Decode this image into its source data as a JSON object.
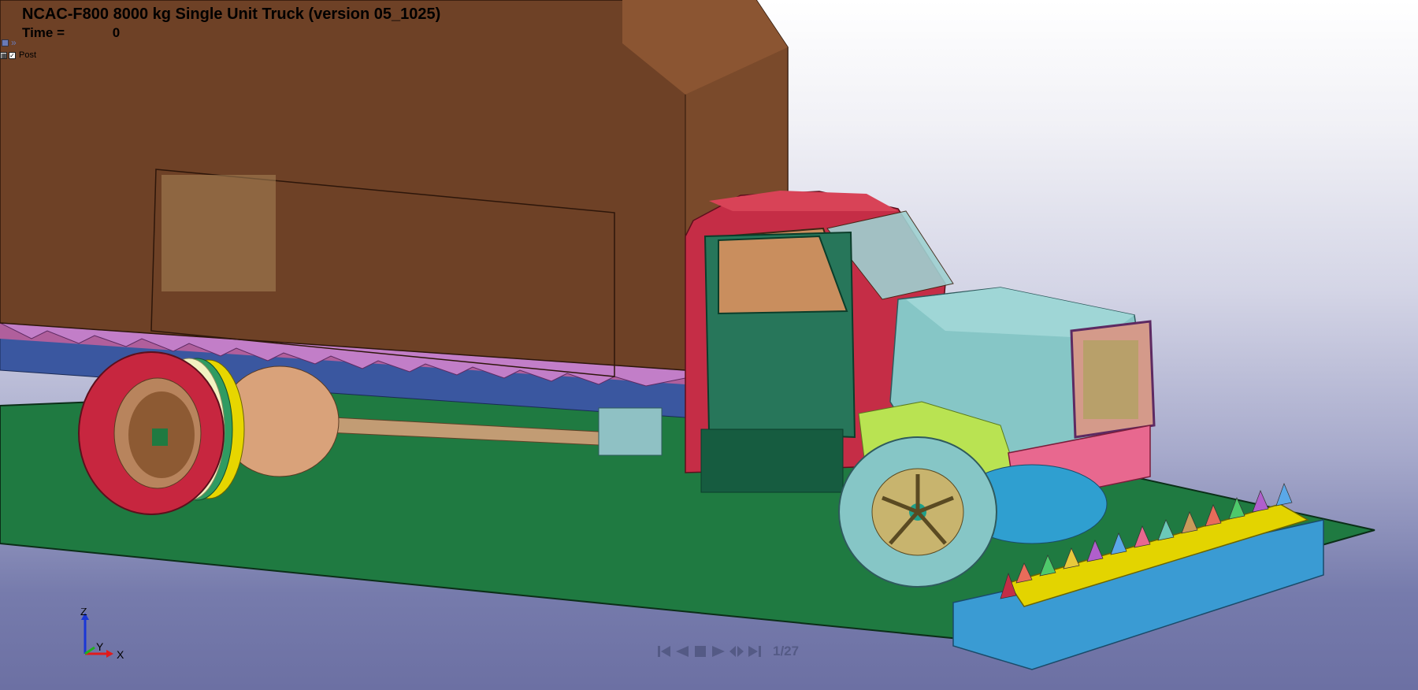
{
  "title": "NCAC-F800 8000 kg Single Unit Truck (version 05_1025)",
  "time": {
    "label": "Time =",
    "value": "0"
  },
  "post_label": "Post",
  "animation": {
    "frame": "1/27"
  },
  "axes": {
    "z": "Z",
    "y": "Y",
    "x": "X"
  },
  "colors": {
    "cargo_box": "#6e4126",
    "cab": "#c52d46",
    "hood": "#86c6c6",
    "door": "#27765a",
    "ground": "#1f7a41",
    "barrier_blue": "#3a9bd3",
    "barrier_yellow": "#e3d400"
  },
  "icons": [
    "first-frame-icon",
    "step-back-icon",
    "stop-icon",
    "play-icon",
    "step-forward-icon",
    "last-frame-icon"
  ]
}
